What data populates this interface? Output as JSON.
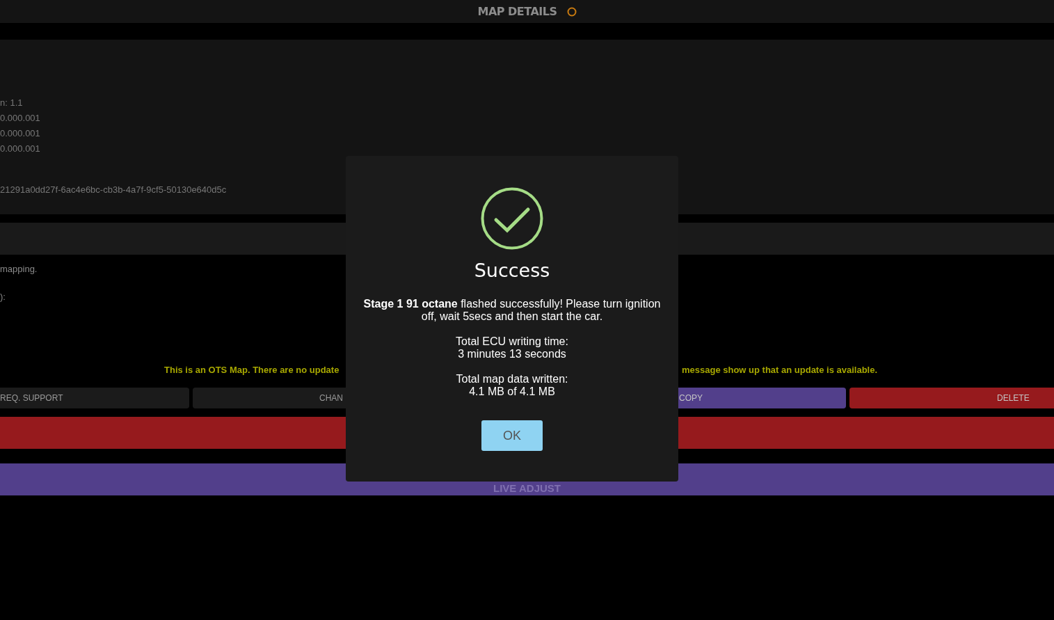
{
  "header": {
    "title": "MAP DETAILS"
  },
  "info_lines": [
    "n: 1.1",
    "0.000.001",
    "0.000.001",
    "0.000.001"
  ],
  "map_id": "21291a0dd27f-6ac4e6bc-cb3b-4a7f-9cf5-50130e640d5c",
  "notes": [
    "mapping.",
    "):"
  ],
  "notice": {
    "left": "This is an OTS Map. There are no update",
    "right": "message show up that an update is available."
  },
  "buttons": [
    {
      "label": "REQ. SUPPORT",
      "kind": "neutral"
    },
    {
      "label": "CHAN",
      "kind": "neutral"
    },
    {
      "label": "COPY",
      "kind": "purple"
    },
    {
      "label": "DELETE",
      "kind": "red"
    }
  ],
  "live_adjust": "LIVE ADJUST",
  "dialog": {
    "title": "Success",
    "message": "**Stage 1 91 octane** flashed successfully! Please turn ignition off, wait 5secs and then start the car.",
    "details": [
      [
        "Total ECU writing time:",
        "3 minutes 13 seconds"
      ],
      [
        "Total map data written:",
        "4.1 MB of 4.1 MB"
      ]
    ],
    "ok": "OK"
  }
}
